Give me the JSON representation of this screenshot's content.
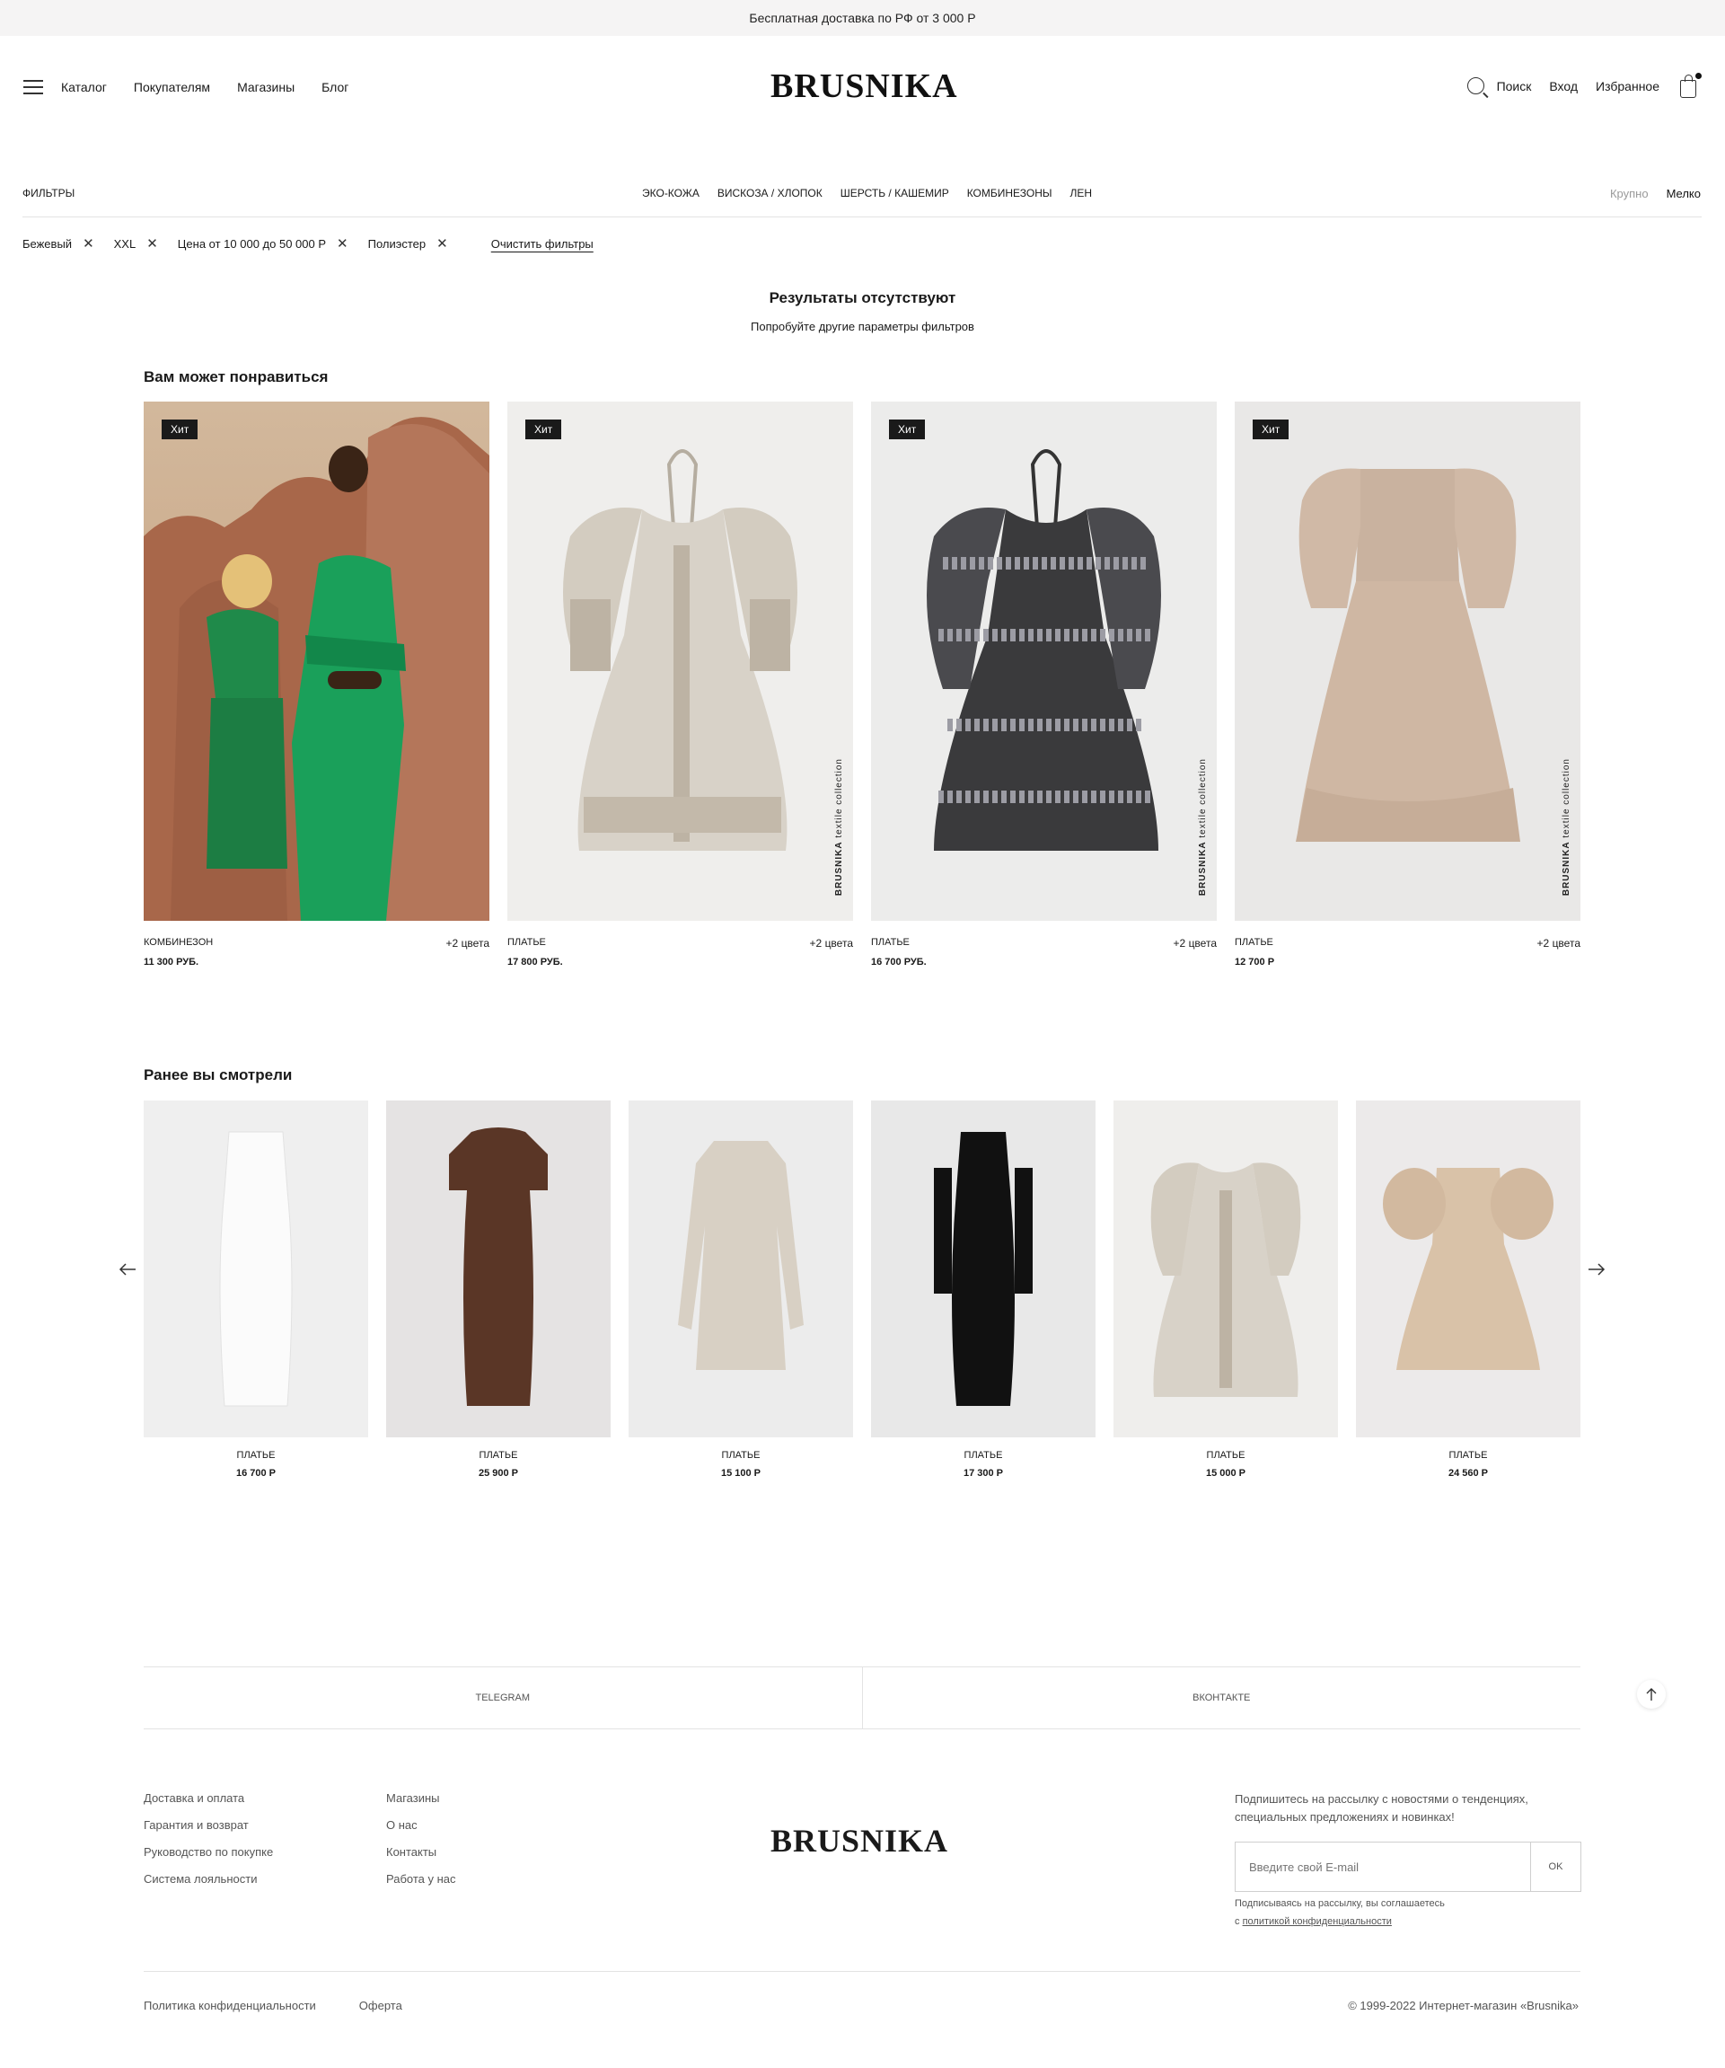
{
  "topbar": {
    "text": "Бесплатная доставка по РФ от 3 000 Р"
  },
  "header": {
    "nav": [
      "Каталог",
      "Покупателям",
      "Магазины",
      "Блог"
    ],
    "logo": "BRUSNIKA",
    "search": "Поиск",
    "login": "Вход",
    "favorites": "Избранное"
  },
  "filters": {
    "label": "ФИЛЬТРЫ",
    "categories": [
      "ЭКО-КОЖА",
      "ВИСКОЗА / ХЛОПОК",
      "ШЕРСТЬ / КАШЕМИР",
      "КОМБИНЕЗОНЫ",
      "ЛЕН"
    ],
    "view_large": "Крупно",
    "view_small": "Мелко",
    "active": [
      "Бежевый",
      "XXL",
      "Цена от 10 000 до 50 000 Р",
      "Полиэстер"
    ],
    "clear": "Очистить фильтры"
  },
  "results": {
    "title": "Результаты отсутствуют",
    "subtitle": "Попробуйте другие параметры фильтров"
  },
  "recommended": {
    "title": "Вам может понравиться",
    "brand_mark": "BRUSNIKA",
    "brand_sub": "textile collection",
    "items": [
      {
        "badge": "Хит",
        "type": "КОМБИНЕЗОН",
        "colors": "+2 цвета",
        "price": "11 300 РУБ.",
        "bg": "#c9a88a"
      },
      {
        "badge": "Хит",
        "type": "ПЛАТЬЕ",
        "colors": "+2 цвета",
        "price": "17 800 РУБ.",
        "bg": "#efeeec"
      },
      {
        "badge": "Хит",
        "type": "ПЛАТЬЕ",
        "colors": "+2 цвета",
        "price": "16 700 РУБ.",
        "bg": "#ececeb"
      },
      {
        "badge": "Хит",
        "type": "ПЛАТЬЕ",
        "colors": "+2 цвета",
        "price": "12 700 Р",
        "bg": "#e9e8e7"
      }
    ]
  },
  "viewed": {
    "title": "Ранее вы смотрели",
    "items": [
      {
        "type": "ПЛАТЬЕ",
        "price": "16 700 Р",
        "bg": "#efefef"
      },
      {
        "type": "ПЛАТЬЕ",
        "price": "25 900 Р",
        "bg": "#e5e3e3"
      },
      {
        "type": "ПЛАТЬЕ",
        "price": "15 100 Р",
        "bg": "#ececec"
      },
      {
        "type": "ПЛАТЬЕ",
        "price": "17 300 Р",
        "bg": "#e8e8e8"
      },
      {
        "type": "ПЛАТЬЕ",
        "price": "15 000 Р",
        "bg": "#efeeec"
      },
      {
        "type": "ПЛАТЬЕ",
        "price": "24 560 Р",
        "bg": "#eceaea"
      }
    ]
  },
  "social": {
    "telegram": "TELEGRAM",
    "vk": "ВКОНТАКТЕ"
  },
  "footer": {
    "col1": [
      "Доставка и оплата",
      "Гарантия и возврат",
      "Руководство по покупке",
      "Система лояльности"
    ],
    "col2": [
      "Магазины",
      "О нас",
      "Контакты",
      "Работа у нас"
    ],
    "logo": "BRUSNIKA",
    "subscribe_text": "Подпишитесь на рассылку с новостями о тенденциях, специальных предложениях и новинках!",
    "email_placeholder": "Введите свой E-mail",
    "ok": "OK",
    "consent_line1": "Подписываясь на рассылку, вы соглашаетесь",
    "consent_prefix": "с",
    "consent_link": "политикой конфиденциальности",
    "privacy": "Политика конфиденциальности",
    "offer": "Оферта",
    "copyright": "© 1999-2022 Интернет-магазин «Brusnika»"
  },
  "colors": {
    "accent": "#1a1a1a",
    "muted": "#9a9a9a",
    "divider": "#e3e3e3"
  }
}
